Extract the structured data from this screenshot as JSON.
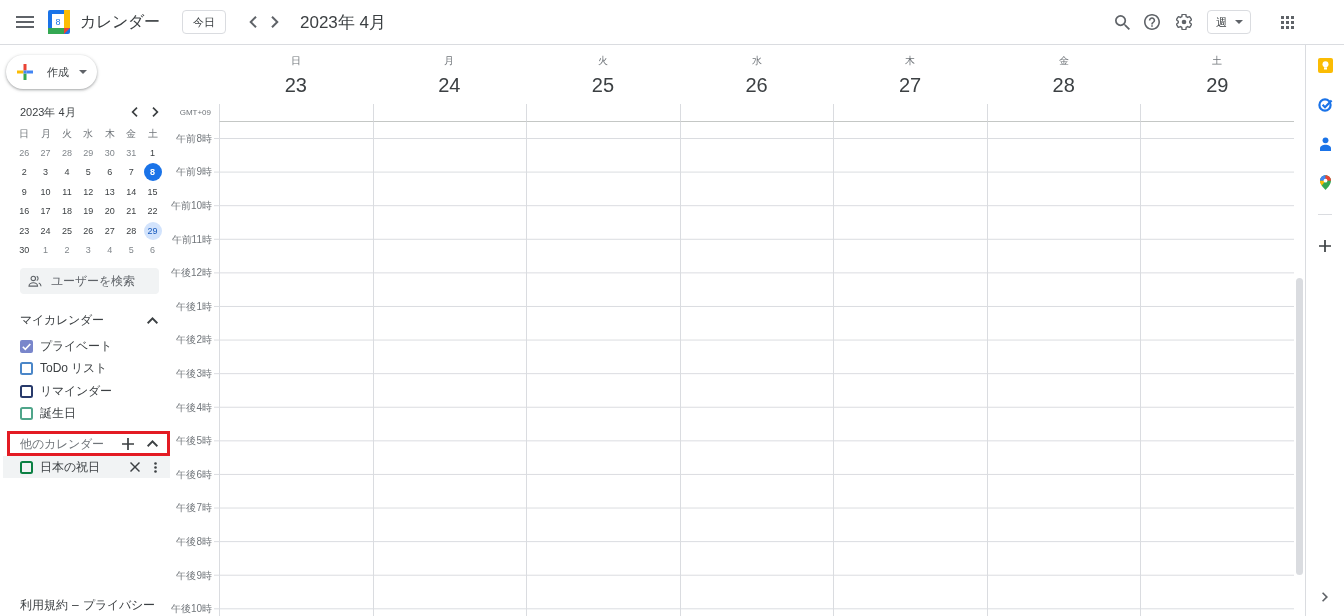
{
  "header": {
    "app_name": "カレンダー",
    "logo_day": "8",
    "today_button": "今日",
    "period": "2023年 4月",
    "view_selector": "週"
  },
  "sidebar": {
    "create_button": "作成",
    "mini_calendar": {
      "title": "2023年 4月",
      "weekdays": [
        "日",
        "月",
        "火",
        "水",
        "木",
        "金",
        "土"
      ],
      "weeks": [
        [
          {
            "day": "26",
            "in_month": false,
            "today": false,
            "selected": false
          },
          {
            "day": "27",
            "in_month": false,
            "today": false,
            "selected": false
          },
          {
            "day": "28",
            "in_month": false,
            "today": false,
            "selected": false
          },
          {
            "day": "29",
            "in_month": false,
            "today": false,
            "selected": false
          },
          {
            "day": "30",
            "in_month": false,
            "today": false,
            "selected": false
          },
          {
            "day": "31",
            "in_month": false,
            "today": false,
            "selected": false
          },
          {
            "day": "1",
            "in_month": true,
            "today": false,
            "selected": false
          }
        ],
        [
          {
            "day": "2",
            "in_month": true,
            "today": false,
            "selected": false
          },
          {
            "day": "3",
            "in_month": true,
            "today": false,
            "selected": false
          },
          {
            "day": "4",
            "in_month": true,
            "today": false,
            "selected": false
          },
          {
            "day": "5",
            "in_month": true,
            "today": false,
            "selected": false
          },
          {
            "day": "6",
            "in_month": true,
            "today": false,
            "selected": false
          },
          {
            "day": "7",
            "in_month": true,
            "today": false,
            "selected": false
          },
          {
            "day": "8",
            "in_month": true,
            "today": true,
            "selected": false
          }
        ],
        [
          {
            "day": "9",
            "in_month": true,
            "today": false,
            "selected": false
          },
          {
            "day": "10",
            "in_month": true,
            "today": false,
            "selected": false
          },
          {
            "day": "11",
            "in_month": true,
            "today": false,
            "selected": false
          },
          {
            "day": "12",
            "in_month": true,
            "today": false,
            "selected": false
          },
          {
            "day": "13",
            "in_month": true,
            "today": false,
            "selected": false
          },
          {
            "day": "14",
            "in_month": true,
            "today": false,
            "selected": false
          },
          {
            "day": "15",
            "in_month": true,
            "today": false,
            "selected": false
          }
        ],
        [
          {
            "day": "16",
            "in_month": true,
            "today": false,
            "selected": false
          },
          {
            "day": "17",
            "in_month": true,
            "today": false,
            "selected": false
          },
          {
            "day": "18",
            "in_month": true,
            "today": false,
            "selected": false
          },
          {
            "day": "19",
            "in_month": true,
            "today": false,
            "selected": false
          },
          {
            "day": "20",
            "in_month": true,
            "today": false,
            "selected": false
          },
          {
            "day": "21",
            "in_month": true,
            "today": false,
            "selected": false
          },
          {
            "day": "22",
            "in_month": true,
            "today": false,
            "selected": false
          }
        ],
        [
          {
            "day": "23",
            "in_month": true,
            "today": false,
            "selected": false
          },
          {
            "day": "24",
            "in_month": true,
            "today": false,
            "selected": false
          },
          {
            "day": "25",
            "in_month": true,
            "today": false,
            "selected": false
          },
          {
            "day": "26",
            "in_month": true,
            "today": false,
            "selected": false
          },
          {
            "day": "27",
            "in_month": true,
            "today": false,
            "selected": false
          },
          {
            "day": "28",
            "in_month": true,
            "today": false,
            "selected": false
          },
          {
            "day": "29",
            "in_month": true,
            "today": false,
            "selected": true
          }
        ],
        [
          {
            "day": "30",
            "in_month": true,
            "today": false,
            "selected": false
          },
          {
            "day": "1",
            "in_month": false,
            "today": false,
            "selected": false
          },
          {
            "day": "2",
            "in_month": false,
            "today": false,
            "selected": false
          },
          {
            "day": "3",
            "in_month": false,
            "today": false,
            "selected": false
          },
          {
            "day": "4",
            "in_month": false,
            "today": false,
            "selected": false
          },
          {
            "day": "5",
            "in_month": false,
            "today": false,
            "selected": false
          },
          {
            "day": "6",
            "in_month": false,
            "today": false,
            "selected": false
          }
        ]
      ]
    },
    "people_search": {
      "placeholder": "ユーザーを検索"
    },
    "my_calendars": {
      "title": "マイカレンダー",
      "expanded": true,
      "items": [
        {
          "label": "プライベート",
          "checked": true,
          "color": "#7986cb"
        },
        {
          "label": "ToDo リスト",
          "checked": false,
          "color": "#4a86c8"
        },
        {
          "label": "リマインダー",
          "checked": false,
          "color": "#283a6b"
        },
        {
          "label": "誕生日",
          "checked": false,
          "color": "#4fa58a"
        }
      ]
    },
    "other_calendars": {
      "title": "他のカレンダー",
      "expanded": true,
      "highlighted": true,
      "items": [
        {
          "label": "日本の祝日",
          "checked": false,
          "color": "#0b8043",
          "hovered": true
        }
      ]
    },
    "footer": {
      "links": [
        "利用規約",
        "プライバシー"
      ],
      "separator": "–"
    }
  },
  "week_view": {
    "days": [
      {
        "weekday": "日",
        "date": "23"
      },
      {
        "weekday": "月",
        "date": "24"
      },
      {
        "weekday": "火",
        "date": "25"
      },
      {
        "weekday": "水",
        "date": "26"
      },
      {
        "weekday": "木",
        "date": "27"
      },
      {
        "weekday": "金",
        "date": "28"
      },
      {
        "weekday": "土",
        "date": "29"
      }
    ],
    "timezone": "GMT+09",
    "hours": [
      "午前8時",
      "午前9時",
      "午前10時",
      "午前11時",
      "午後12時",
      "午後1時",
      "午後2時",
      "午後3時",
      "午後4時",
      "午後5時",
      "午後6時",
      "午後7時",
      "午後8時",
      "午後9時",
      "午後10時"
    ]
  }
}
